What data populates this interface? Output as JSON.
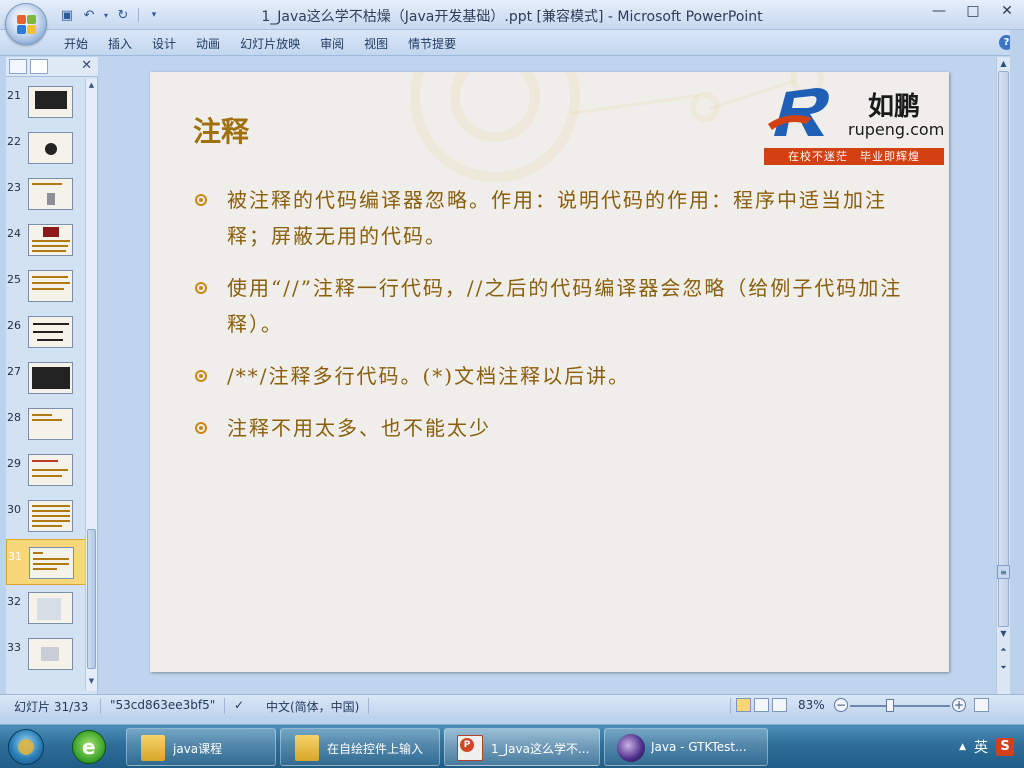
{
  "window": {
    "title": "1_Java这么学不枯燥（Java开发基础）.ppt [兼容模式] - Microsoft PowerPoint",
    "minimize": "—",
    "maximize": "□",
    "close": "✕"
  },
  "ribbon": {
    "tabs": [
      "开始",
      "插入",
      "设计",
      "动画",
      "幻灯片放映",
      "审阅",
      "视图",
      "情节提要"
    ],
    "help": "?"
  },
  "thumbnails": {
    "numbers": [
      "21",
      "22",
      "23",
      "24",
      "25",
      "26",
      "27",
      "28",
      "29",
      "30",
      "31",
      "32",
      "33"
    ],
    "selected": "31"
  },
  "slide": {
    "title": "注释",
    "logo_cn": "如鹏",
    "logo_en": "rupeng.com",
    "logo_tagline": "在校不迷茫　毕业即辉煌",
    "bullets": [
      "被注释的代码编译器忽略。作用：说明代码的作用：程序中适当加注释；屏蔽无用的代码。",
      "使用“//”注释一行代码，//之后的代码编译器会忽略（给例子代码加注释）。",
      "/**/注释多行代码。(*)文档注释以后讲。",
      "注释不用太多、也不能太少"
    ]
  },
  "status": {
    "slide_info": "幻灯片 31/33",
    "theme": "\"53cd863ee3bf5\"",
    "language": "中文(简体，中国)",
    "zoom": "83%",
    "zoom_minus": "−",
    "zoom_plus": "+"
  },
  "taskbar": {
    "items": [
      "java课程",
      "在自绘控件上输入",
      "1_Java这么学不...",
      "Java - GTKTest..."
    ],
    "active": "1_Java这么学不...",
    "tray_lang": "英",
    "tray_s": "S",
    "tray_arrow": "▲"
  }
}
